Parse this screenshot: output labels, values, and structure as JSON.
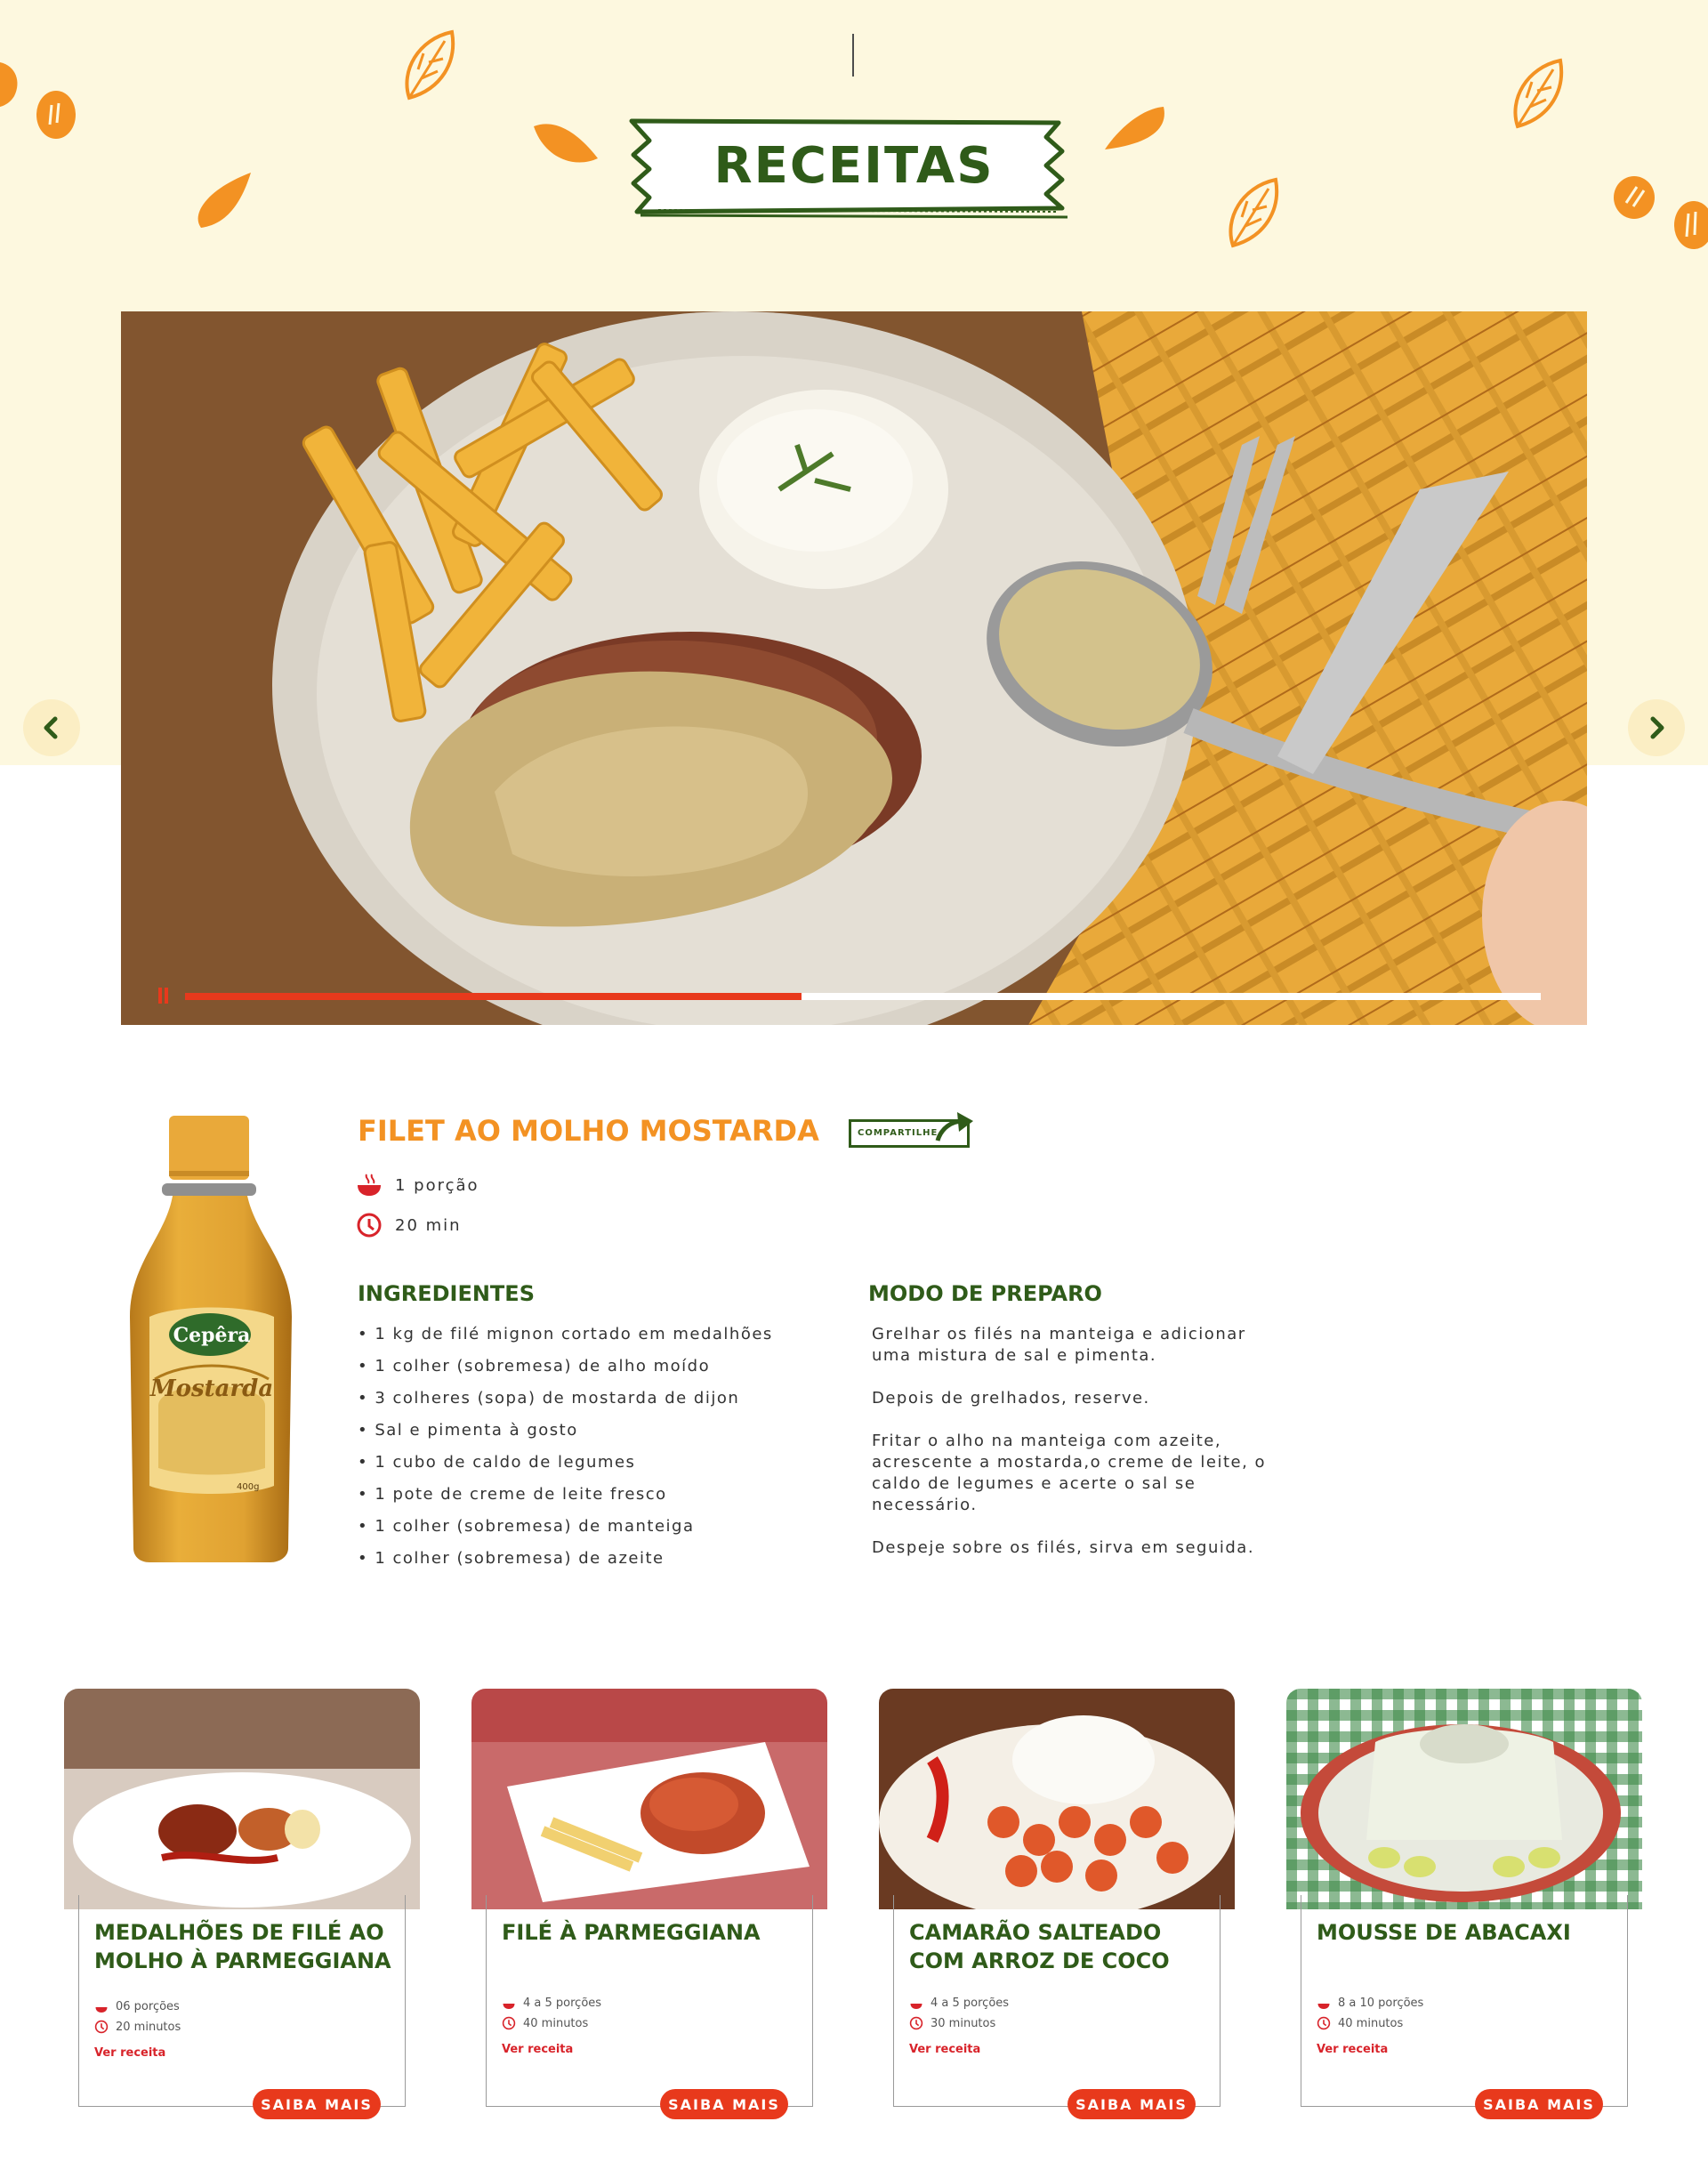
{
  "header": {
    "title": "RECEITAS"
  },
  "carousel": {
    "progress": 0.455,
    "prev_icon": "chevron-left-icon",
    "next_icon": "chevron-right-icon"
  },
  "recipe": {
    "title": "FILET AO MOLHO MOSTARDA",
    "share_label": "COMPARTILHE",
    "servings": "1 porção",
    "time": "20 min",
    "ingredients_title": "INGREDIENTES",
    "ingredients": [
      "1 kg de filé mignon cortado em medalhões",
      "1 colher (sobremesa) de alho moído",
      "3 colheres (sopa) de mostarda de dijon",
      "Sal e pimenta à gosto",
      "1 cubo de caldo de legumes",
      "1 pote de creme de leite fresco",
      "1 colher (sobremesa) de manteiga",
      "1 colher (sobremesa) de azeite"
    ],
    "method_title": "MODO DE PREPARO",
    "method": [
      "Grelhar os filés na manteiga e adicionar uma mistura de sal e pimenta.",
      "Depois de grelhados, reserve.",
      "Fritar o alho na manteiga com azeite, acrescente a mostarda,o creme de leite, o caldo de legumes e acerte o sal se necessário.",
      "Despeje sobre os filés, sirva em seguida."
    ]
  },
  "product": {
    "brand": "Cepêra",
    "name": "Mostarda",
    "weight": "400g"
  },
  "related": [
    {
      "title": "MEDALHÕES DE FILÉ AO MOLHO À PARMEGGIANA",
      "servings": "06 porções",
      "time": "20 minutos",
      "link": "Ver receita",
      "button": "SAIBA MAIS"
    },
    {
      "title": "FILÉ À PARMEGGIANA",
      "servings": "4 a 5 porções",
      "time": "40 minutos",
      "link": "Ver receita",
      "button": "SAIBA MAIS"
    },
    {
      "title": "CAMARÃO SALTEADO COM ARROZ DE COCO",
      "servings": "4 a 5 porções",
      "time": "30 minutos",
      "link": "Ver receita",
      "button": "SAIBA MAIS"
    },
    {
      "title": "MOUSSE DE ABACAXI",
      "servings": "8 a 10 porções",
      "time": "40 minutos",
      "link": "Ver receita",
      "button": "SAIBA MAIS"
    }
  ],
  "colors": {
    "accent_green": "#2f5b19",
    "accent_orange": "#f39223",
    "accent_red": "#e8391c",
    "hero_bg": "#fdf8df"
  }
}
